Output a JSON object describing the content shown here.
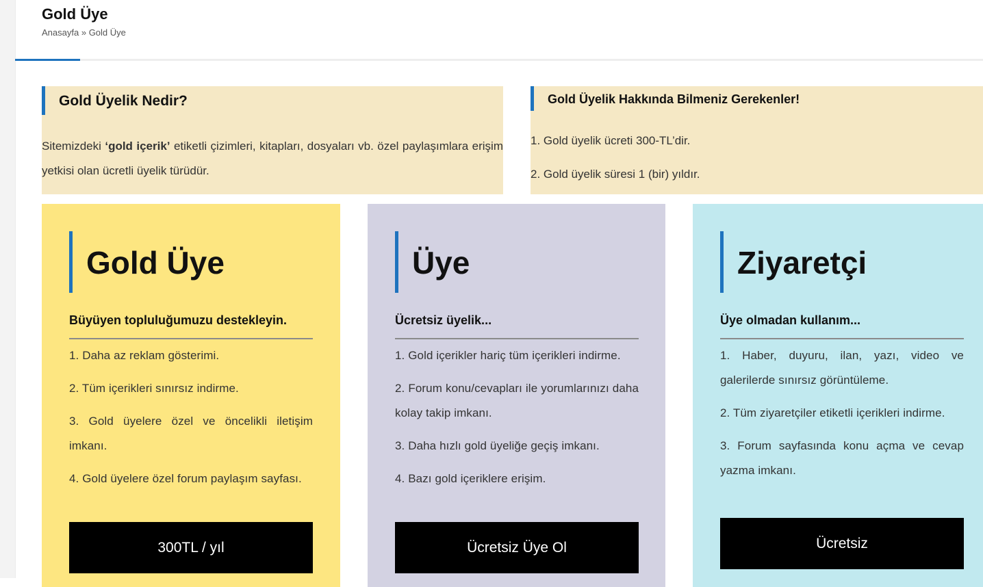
{
  "page": {
    "title": "Gold Üye",
    "breadcrumb": {
      "home": "Anasayfa",
      "separator": "»",
      "current": "Gold Üye"
    }
  },
  "info_left": {
    "heading": "Gold Üyelik Nedir?",
    "text_before": "Sitemizdeki ",
    "text_bold": "‘gold içerik’",
    "text_after": " etiketli çizimleri, kitapları, dosyaları vb. özel paylaşımlara erişim yetkisi olan ücretli üyelik türüdür."
  },
  "info_right": {
    "heading": "Gold Üyelik Hakkında Bilmeniz Gerekenler!",
    "items": [
      "1. Gold üyelik ücreti 300-TL’dir.",
      "2. Gold üyelik süresi 1 (bir) yıldır."
    ]
  },
  "plans": [
    {
      "title": "Gold Üye",
      "subtitle": "Büyüyen topluluğumuzu destekleyin.",
      "features": [
        "1. Daha az reklam gösterimi.",
        "2. Tüm içerikleri sınırsız indirme.",
        "3. Gold üyelere özel ve öncelikli iletişim imkanı.",
        "4. Gold üyelere özel forum paylaşım sayfası."
      ],
      "button": "300TL / yıl"
    },
    {
      "title": "Üye",
      "subtitle": "Ücretsiz üyelik...",
      "features": [
        "1. Gold içerikler hariç tüm içerikleri indirme.",
        "2. Forum konu/cevapları ile yorumlarınızı daha kolay takip imkanı.",
        "3. Daha hızlı gold üyeliğe geçiş imkanı.",
        "4. Bazı gold içeriklere erişim."
      ],
      "button": "Ücretsiz Üye Ol"
    },
    {
      "title": "Ziyaretçi",
      "subtitle": "Üye olmadan kullanım...",
      "features": [
        "1. Haber, duyuru, ilan, yazı, video ve galerilerde sınırsız görüntüleme.",
        "2. Tüm ziyaretçiler etiketli içerikleri indirme.",
        "3. Forum sayfasında konu açma ve cevap yazma imkanı."
      ],
      "button": "Ücretsiz"
    }
  ],
  "colors": {
    "accent": "#1e73be",
    "info_bg": "#f5e8c5",
    "gold_card": "#fde681",
    "member_card": "#d3d2e2",
    "visitor_card": "#c1e9ef",
    "button_bg": "#000000"
  }
}
